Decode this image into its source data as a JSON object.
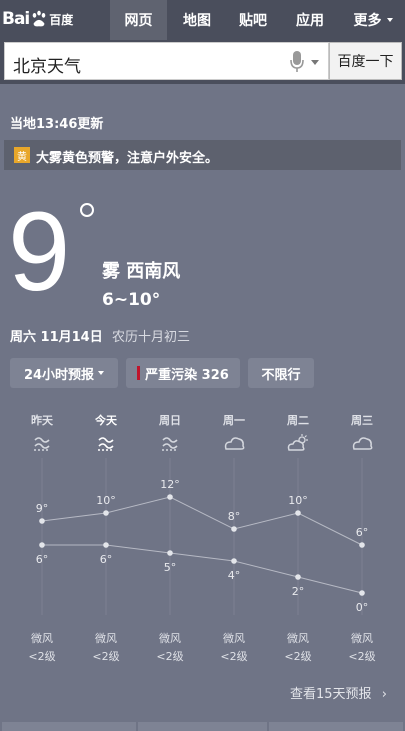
{
  "header": {
    "logo_text": "Bai",
    "logo_suffix": "百度",
    "nav": [
      {
        "label": "网页",
        "active": true
      },
      {
        "label": "地图",
        "active": false
      },
      {
        "label": "贴吧",
        "active": false
      },
      {
        "label": "应用",
        "active": false
      },
      {
        "label": "更多",
        "active": false
      }
    ]
  },
  "search": {
    "query": "北京天气",
    "button": "百度一下"
  },
  "weather": {
    "updated": "当地13:46更新",
    "alert_tag": "黄",
    "alert_text": "大雾黄色预警，注意户外安全。",
    "temp": "9",
    "condition": "雾  西南风",
    "range": "6~10°",
    "date": "周六 11月14日",
    "lunar": "农历十月初三",
    "chips": [
      "24小时预报",
      "严重污染 326",
      "不限行"
    ],
    "alert_color": "#e8a72a",
    "pollution_color": "#c0142c"
  },
  "forecast": {
    "days": [
      {
        "day": "昨天",
        "icon": "fog-icon",
        "high": "9°",
        "low": "6°",
        "wind": "微风",
        "level": "<2级"
      },
      {
        "day": "今天",
        "icon": "fog-icon",
        "high": "10°",
        "low": "6°",
        "wind": "微风",
        "level": "<2级"
      },
      {
        "day": "周日",
        "icon": "fog-icon",
        "high": "12°",
        "low": "5°",
        "wind": "微风",
        "level": "<2级"
      },
      {
        "day": "周一",
        "icon": "cloud-icon",
        "high": "8°",
        "low": "4°",
        "wind": "微风",
        "level": "<2级"
      },
      {
        "day": "周二",
        "icon": "partly-cloudy-icon",
        "high": "10°",
        "low": "2°",
        "wind": "微风",
        "level": "<2级"
      },
      {
        "day": "周三",
        "icon": "cloud-icon",
        "high": "6°",
        "low": "0°",
        "wind": "微风",
        "level": "<2级"
      }
    ],
    "more_link": "查看15天预报"
  },
  "chart_data": {
    "type": "line",
    "categories": [
      "昨天",
      "今天",
      "周日",
      "周一",
      "周二",
      "周三"
    ],
    "series": [
      {
        "values": [
          9,
          10,
          12,
          8,
          10,
          6
        ]
      },
      {
        "values": [
          6,
          6,
          5,
          4,
          2,
          0
        ]
      }
    ]
  }
}
